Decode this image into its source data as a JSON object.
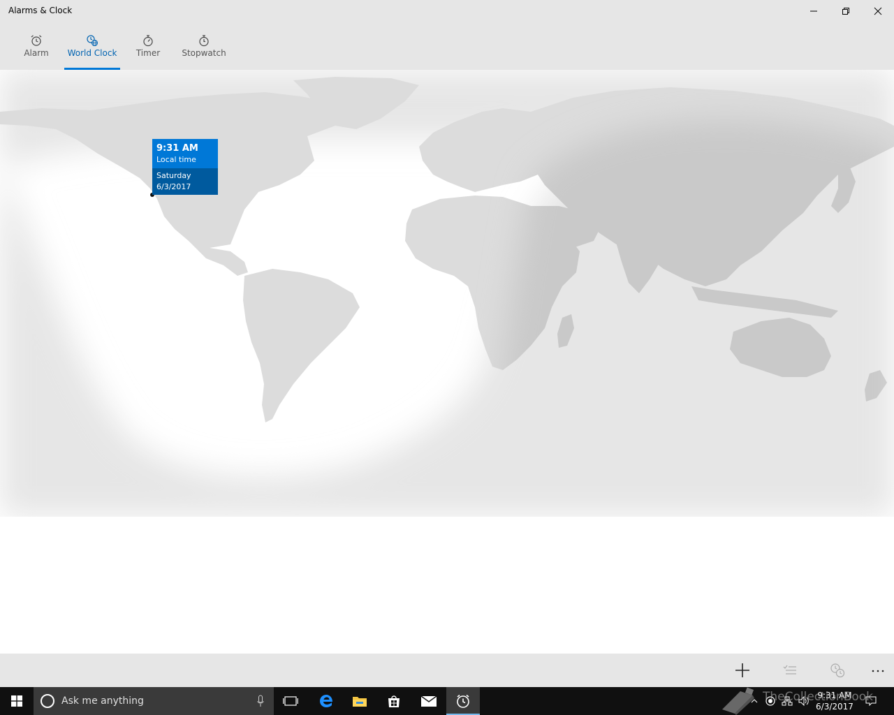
{
  "window": {
    "title": "Alarms & Clock",
    "controls": [
      "minimize-icon",
      "restore-icon",
      "close-icon"
    ]
  },
  "tabs": [
    {
      "label": "Alarm",
      "icon": "alarm-clock-icon",
      "active": false
    },
    {
      "label": "World Clock",
      "icon": "world-clock-icon",
      "active": true
    },
    {
      "label": "Timer",
      "icon": "timer-icon",
      "active": false
    },
    {
      "label": "Stopwatch",
      "icon": "stopwatch-icon",
      "active": false
    }
  ],
  "tooltip": {
    "time": "9:31 AM",
    "label": "Local time",
    "day": "Saturday",
    "date": "6/3/2017"
  },
  "colors": {
    "accent": "#0078d7",
    "accent_dark": "#005a9e",
    "land": "#dcdcdc",
    "night": "#c8c8c8",
    "chrome": "#e6e6e6",
    "taskbar": "#101010"
  },
  "command_bar": {
    "buttons": [
      "add-icon",
      "edit-list-icon",
      "compare-clocks-icon",
      "more-icon"
    ]
  },
  "taskbar": {
    "search_placeholder": "Ask me anything",
    "apps": [
      "task-view-icon",
      "edge-icon",
      "file-explorer-icon",
      "store-icon",
      "mail-icon",
      "alarms-icon"
    ],
    "clock_time": "9:31 AM",
    "clock_date": "6/3/2017"
  },
  "watermark": {
    "text": "TheCollectionBook"
  }
}
